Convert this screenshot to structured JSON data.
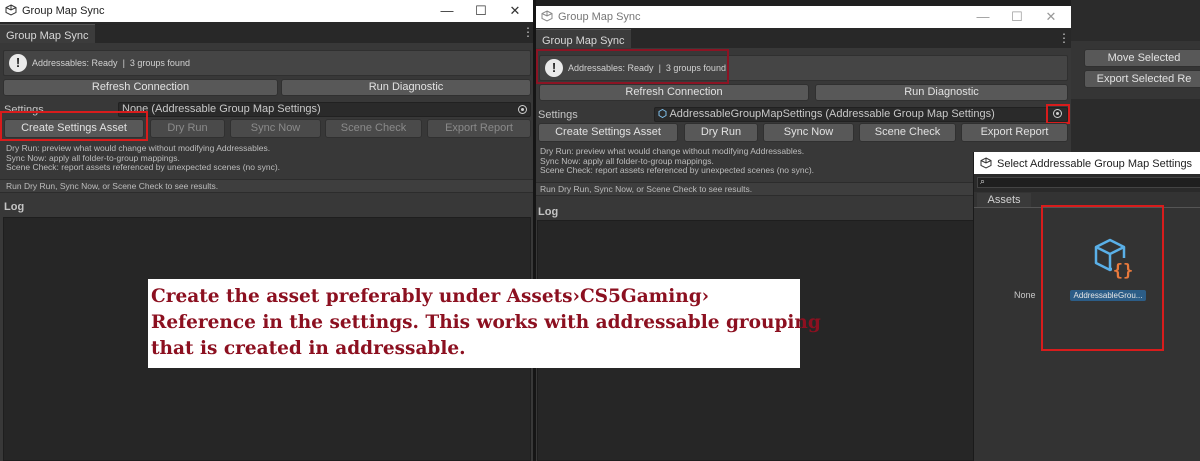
{
  "left_window": {
    "title": "Group Map Sync",
    "tab": "Group Map Sync",
    "status": "Addressables: Ready",
    "groups": "3 groups found",
    "refresh_label": "Refresh Connection",
    "diagnostic_label": "Run Diagnostic",
    "settings_label": "Settings",
    "settings_value": "None (Addressable Group Map Settings)",
    "buttons": [
      "Create Settings Asset",
      "Dry Run",
      "Sync Now",
      "Scene Check",
      "Export Report"
    ],
    "desc": [
      "Dry Run: preview what would change without modifying Addressables.",
      "Sync Now: apply all folder-to-group mappings.",
      "Scene Check: report assets referenced by unexpected scenes (no sync)."
    ],
    "status_line": "Run Dry Run, Sync Now, or Scene Check to see results.",
    "log_label": "Log"
  },
  "right_window": {
    "title": "Group Map Sync",
    "tab": "Group Map Sync",
    "status": "Addressables: Ready",
    "groups": "3 groups found",
    "refresh_label": "Refresh Connection",
    "diagnostic_label": "Run Diagnostic",
    "settings_label": "Settings",
    "settings_value": "AddressableGroupMapSettings (Addressable Group Map Settings)",
    "buttons": [
      "Create Settings Asset",
      "Dry Run",
      "Sync Now",
      "Scene Check",
      "Export Report"
    ],
    "desc": [
      "Dry Run: preview what would change without modifying Addressables.",
      "Sync Now: apply all folder-to-group mappings.",
      "Scene Check: report assets referenced by unexpected scenes (no sync)."
    ],
    "status_line": "Run Dry Run, Sync Now, or Scene Check to see results.",
    "log_label": "Log"
  },
  "background_panel": {
    "move_selected": "Move Selected",
    "export_selected": "Export Selected Re"
  },
  "select_dialog": {
    "title": "Select Addressable Group Map Settings",
    "tab": "Assets",
    "none_label": "None",
    "item_label": "AddressableGrou..."
  },
  "annotation": {
    "lines": [
      "Create the asset preferably under Assets›CS5Gaming›",
      "Reference in the settings. This works with addressable grouping",
      "that is created in addressable."
    ]
  },
  "icons": {
    "window": "unity-cube-icon",
    "help": "exclamation-bubble-icon",
    "picker": "object-picker-icon",
    "search": "search-icon",
    "asset": "scriptable-object-icon"
  },
  "colors": {
    "highlight_red": "#d81c1c",
    "annotation_red": "#8c1020",
    "selection_blue": "#2c5d87",
    "asset_icon_blue": "#5ab0e8",
    "asset_icon_orange": "#e8793c"
  }
}
